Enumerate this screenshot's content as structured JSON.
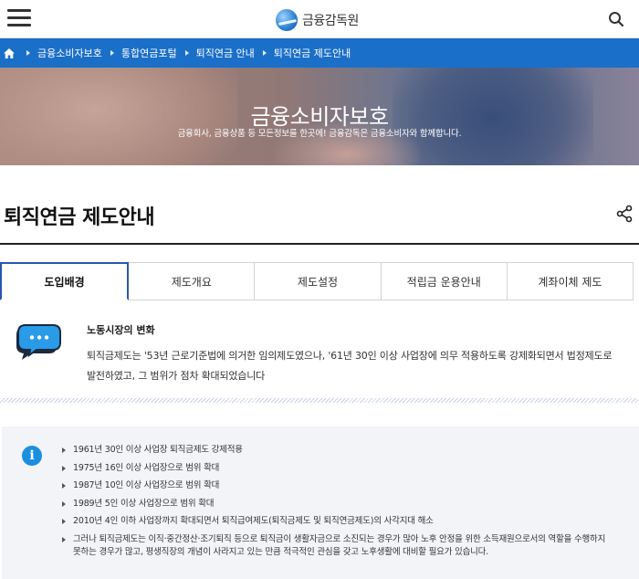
{
  "header": {
    "logo_text": "금융감독원"
  },
  "breadcrumb": {
    "items": [
      "금융소비자보호",
      "통합연금포털",
      "퇴직연금 안내",
      "퇴직연금 제도안내"
    ]
  },
  "hero": {
    "title": "금융소비자보호",
    "description": "금융회사, 금융상품 등 모든정보를 한곳에! 금융감독은 금융소비자와 함께합니다."
  },
  "page": {
    "title": "퇴직연금 제도안내"
  },
  "tabs": [
    {
      "label": "도입배경",
      "active": true
    },
    {
      "label": "제도개요",
      "active": false
    },
    {
      "label": "제도설정",
      "active": false
    },
    {
      "label": "적립금 운용안내",
      "active": false
    },
    {
      "label": "계좌이체 제도",
      "active": false
    }
  ],
  "labor": {
    "title": "노동시장의 변화",
    "text": "퇴직금제도는 '53년 근로기준법에 의거한 임의제도였으나, '61년 30인 이상 사업장에 의무 적용하도록 강제화되면서 법정제도로 발전하였고, 그 범위가 점차 확대되었습니다"
  },
  "info": {
    "items": [
      "1961년 30인 이상 사업장 퇴직금제도 강제적용",
      "1975년 16인 이상 사업장으로 범위 확대",
      "1987년 10인 이상 사업장으로 범위 확대",
      "1989년 5인 이상 사업장으로 범위 확대",
      "2010년 4인 이하 사업장까지 확대되면서 퇴직급여제도(퇴직금제도 및 퇴직연금제도)의 사각지대 해소",
      "그러나 퇴직금제도는 이직·중간정산·조기퇴직 등으로 퇴직금이 생활자금으로 소진되는 경우가 많아 노후 안정을 위한 소득재원으로서의 역할을 수행하지 못하는 경우가 많고, 평생직장의 개념이 사라지고 있는 만큼 적극적인 관심을 갖고 노후생활에 대비할 필요가 있습니다."
    ]
  },
  "colors": {
    "brand_blue": "#1a6fc9",
    "tab_active_border": "#2a55b0",
    "info_icon": "#1a8fe0"
  }
}
